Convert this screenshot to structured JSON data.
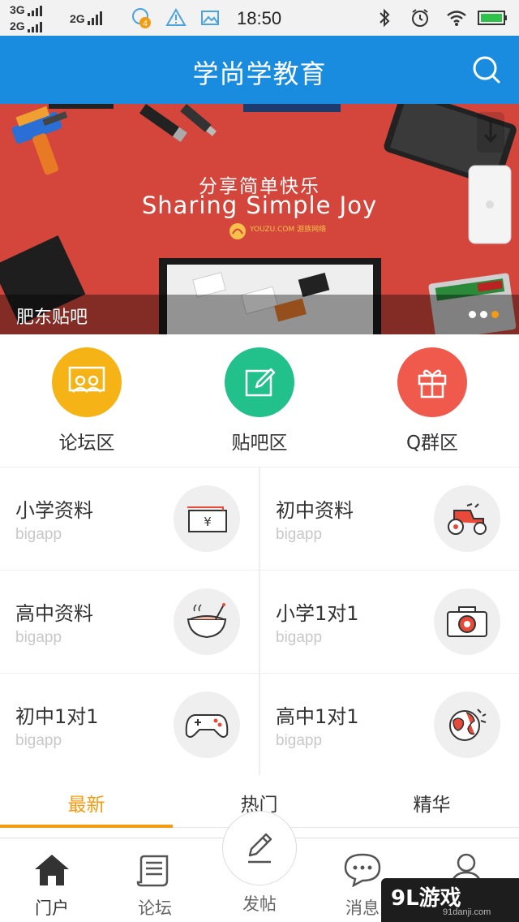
{
  "status_bar": {
    "sim1": "3G",
    "sim2": "2G",
    "sim3": "2G",
    "notification_badge": "4",
    "time": "18:50"
  },
  "header": {
    "title": "学尚学教育",
    "search_icon": "search-icon"
  },
  "banner": {
    "headline_cn": "分享简单快乐",
    "headline_en": "Sharing Simple Joy",
    "logo_text": "YOUZU.COM 游族网络",
    "caption": "肥东贴吧",
    "active_dot": 2,
    "dot_count": 3
  },
  "quick_links": [
    {
      "label": "论坛区",
      "icon": "people-board-icon",
      "color": "#f5b316"
    },
    {
      "label": "贴吧区",
      "icon": "edit-icon",
      "color": "#22c08a"
    },
    {
      "label": "Q群区",
      "icon": "gift-icon",
      "color": "#ef5a4c"
    }
  ],
  "grid": [
    {
      "title": "小学资料",
      "sub": "bigapp",
      "icon": "ticket-yen-icon"
    },
    {
      "title": "初中资料",
      "sub": "bigapp",
      "icon": "tractor-icon"
    },
    {
      "title": "高中资料",
      "sub": "bigapp",
      "icon": "bowl-icon"
    },
    {
      "title": "小学1对1",
      "sub": "bigapp",
      "icon": "camera-icon"
    },
    {
      "title": "初中1对1",
      "sub": "bigapp",
      "icon": "gamepad-icon"
    },
    {
      "title": "高中1对1",
      "sub": "bigapp",
      "icon": "globe-icon"
    }
  ],
  "tabs": [
    {
      "label": "最新",
      "active": true
    },
    {
      "label": "热门",
      "active": false
    },
    {
      "label": "精华",
      "active": false
    }
  ],
  "bottom_nav": [
    {
      "label": "门户",
      "icon": "home-icon",
      "active": true
    },
    {
      "label": "论坛",
      "icon": "scroll-icon",
      "active": false
    },
    {
      "label": "发帖",
      "icon": "pen-icon",
      "active": false
    },
    {
      "label": "消息",
      "icon": "chat-icon",
      "active": false
    },
    {
      "label": "我的",
      "icon": "user-icon",
      "active": false
    }
  ],
  "watermark": {
    "main": "9L游戏",
    "sub": "91danji.com"
  },
  "colors": {
    "header": "#1a8ce0",
    "accent": "#f39c12",
    "banner": "#d4463c"
  }
}
